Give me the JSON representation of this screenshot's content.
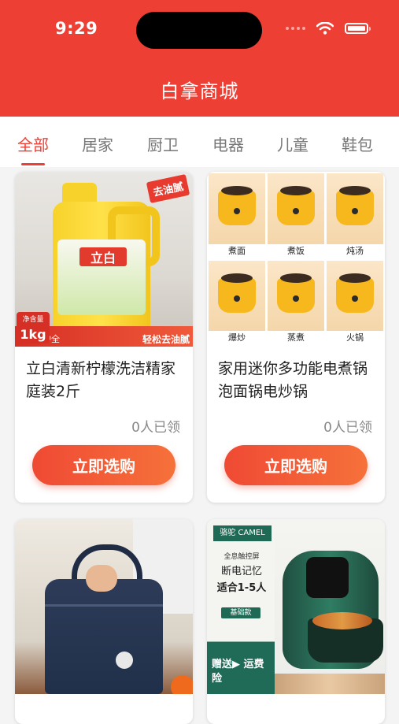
{
  "status_bar": {
    "time": "9:29",
    "icons": [
      "cellular-dots-icon",
      "wifi-icon",
      "battery-icon"
    ]
  },
  "app": {
    "title": "白拿商城",
    "accent_color": "#ee3f35"
  },
  "tabs": [
    {
      "label": "全部",
      "active": true
    },
    {
      "label": "居家",
      "active": false
    },
    {
      "label": "厨卫",
      "active": false
    },
    {
      "label": "电器",
      "active": false
    },
    {
      "label": "儿童",
      "active": false
    },
    {
      "label": "鞋包",
      "active": false
    }
  ],
  "products": [
    {
      "title": "立白清新柠檬洗洁精家庭装2斤",
      "claimed": "0人已领",
      "button_label": "立即选购",
      "image_text": {
        "tag": "去油腻",
        "brand": "立白",
        "badge_top": "净含量",
        "badge_main": "1kg",
        "strip_left": "呵护全家健康",
        "strip_right": "轻松去油腻"
      }
    },
    {
      "title": "家用迷你多功能电煮锅泡面锅电炒锅",
      "claimed": "0人已领",
      "button_label": "立即选购",
      "image_text": {
        "cells": [
          "煮面",
          "煮饭",
          "炖汤",
          "爆炒",
          "蒸煮",
          "火锅"
        ]
      }
    },
    {
      "title": "",
      "claimed": "",
      "button_label": "",
      "image_text": {}
    },
    {
      "title": "",
      "claimed": "",
      "button_label": "",
      "image_text": {
        "brand": "骆驼 CAMEL",
        "line1": "全息触控屏",
        "line2": "断电记忆",
        "line3": "适合1-5人",
        "tag": "基础款",
        "promo": "赠送▶ 运费险"
      }
    }
  ]
}
